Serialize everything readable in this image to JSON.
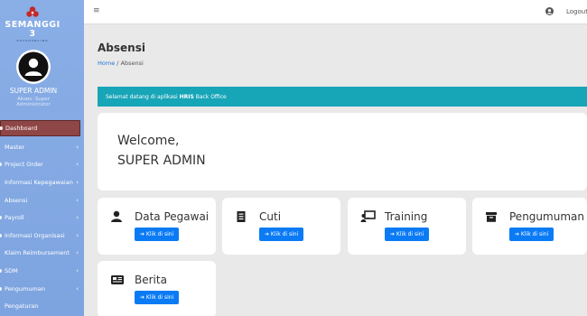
{
  "brand": {
    "name": "SEMANGGI 3",
    "tagline": "OUTSOURCING"
  },
  "user": {
    "name": "SUPER ADMIN",
    "role": "Akses: Super Administrator"
  },
  "sidebar": {
    "items": [
      {
        "label": "Dashboard",
        "active": true,
        "has_arrow": false
      },
      {
        "label": "Master",
        "has_arrow": true
      },
      {
        "label": "Project Order",
        "has_arrow": true
      },
      {
        "label": "Informasi Kepegawaian",
        "has_arrow": true
      },
      {
        "label": "Absensi",
        "has_arrow": true
      },
      {
        "label": "Payroll",
        "has_arrow": true
      },
      {
        "label": "Informasi Organisasi",
        "has_arrow": true
      },
      {
        "label": "Klaim Reimbursement",
        "has_arrow": true
      },
      {
        "label": "SDM",
        "has_arrow": true
      },
      {
        "label": "Pengumuman",
        "has_arrow": true
      },
      {
        "label": "Pengaturan",
        "has_arrow": false
      }
    ]
  },
  "topbar": {
    "menu_icon": "≡",
    "logout_label": "Logout"
  },
  "page": {
    "title": "Absensi",
    "breadcrumb_home": "Home",
    "breadcrumb_sep": "/",
    "breadcrumb_current": "Absensi"
  },
  "alert": {
    "prefix": "Selamat datang di aplikasi ",
    "bold": "HRIS",
    "suffix": " Back Office"
  },
  "welcome": {
    "line1": "Welcome,",
    "line2": "SUPER ADMIN"
  },
  "cards": [
    {
      "title": "Data Pegawai",
      "icon": "user-icon",
      "button": "➔ Klik di sini"
    },
    {
      "title": "Cuti",
      "icon": "document-icon",
      "button": "➔ Klik di sini"
    },
    {
      "title": "Training",
      "icon": "presentation-icon",
      "button": "➔ Klik di sini"
    },
    {
      "title": "Pengumuman",
      "icon": "archive-box-icon",
      "button": "➔ Klik di sini"
    },
    {
      "title": "Berita",
      "icon": "newspaper-icon",
      "button": "➔ Klik di sini"
    }
  ],
  "colors": {
    "sidebar": "#8aaee6",
    "active_item": "#8e4646",
    "alert": "#17a5b8",
    "button": "#0b7bf5"
  }
}
